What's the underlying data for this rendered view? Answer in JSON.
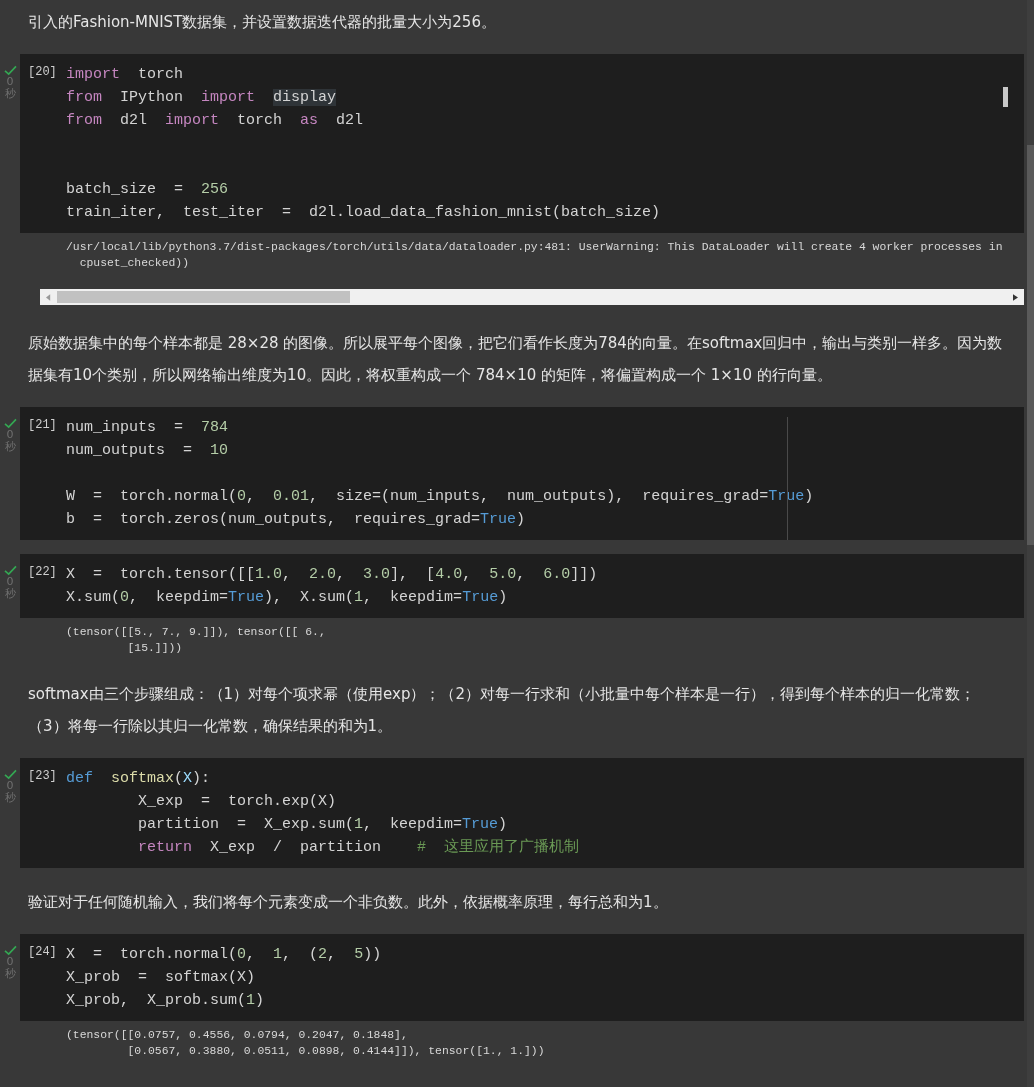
{
  "cells": [
    {
      "kind": "text",
      "text": "引入的Fashion-MNIST数据集，并设置数据迭代器的批量大小为256。"
    },
    {
      "kind": "code",
      "count": "[20]",
      "done": true,
      "time": "0",
      "unit": "秒",
      "cursor_thumb": true,
      "lines": [
        {
          "kind": "code",
          "tokens": [
            {
              "kind": "keyword",
              "text": "import"
            },
            {
              "kind": "plain",
              "text": "  torch"
            }
          ]
        },
        {
          "kind": "code",
          "tokens": [
            {
              "kind": "keyword",
              "text": "from"
            },
            {
              "kind": "plain",
              "text": "  IPython  "
            },
            {
              "kind": "keyword",
              "text": "import  "
            },
            {
              "kind": "highlight",
              "text": "display"
            }
          ]
        },
        {
          "kind": "code",
          "tokens": [
            {
              "kind": "keyword",
              "text": "from"
            },
            {
              "kind": "plain",
              "text": "  d2l  "
            },
            {
              "kind": "keyword",
              "text": "import"
            },
            {
              "kind": "plain",
              "text": "  torch  "
            },
            {
              "kind": "keyword",
              "text": "as"
            },
            {
              "kind": "plain",
              "text": "  d2l"
            }
          ]
        },
        {
          "kind": "blank"
        },
        {
          "kind": "blank"
        },
        {
          "kind": "code",
          "tokens": [
            {
              "kind": "plain",
              "text": "batch_size  =  "
            },
            {
              "kind": "number",
              "text": "256"
            }
          ]
        },
        {
          "kind": "code",
          "tokens": [
            {
              "kind": "plain",
              "text": "train_iter,  test_iter  =  d2l.load_data_fashion_mnist(batch_size)"
            }
          ]
        }
      ],
      "output": {
        "horizontal_scroll": true,
        "lines": [
          "/usr/local/lib/python3.7/dist-packages/torch/utils/data/dataloader.py:481: UserWarning: This DataLoader will create 4 worker processes in",
          "  cpuset_checked))"
        ]
      }
    },
    {
      "kind": "text",
      "text": "原始数据集中的每个样本都是 28×28 的图像。所以展平每个图像，把它们看作长度为784的向量。在softmax回归中，输出与类别一样多。因为数据集有10个类别，所以网络输出维度为10。因此，将权重构成一个 784×10 的矩阵，将偏置构成一个 1×10 的行向量。"
    },
    {
      "kind": "code",
      "count": "[21]",
      "done": true,
      "time": "0",
      "unit": "秒",
      "ruler": true,
      "lines": [
        {
          "kind": "code",
          "tokens": [
            {
              "kind": "plain",
              "text": "num_inputs  =  "
            },
            {
              "kind": "number",
              "text": "784"
            }
          ]
        },
        {
          "kind": "code",
          "tokens": [
            {
              "kind": "plain",
              "text": "num_outputs  =  "
            },
            {
              "kind": "number",
              "text": "10"
            }
          ]
        },
        {
          "kind": "blank"
        },
        {
          "kind": "code",
          "tokens": [
            {
              "kind": "plain",
              "text": "W  =  torch.normal("
            },
            {
              "kind": "number",
              "text": "0"
            },
            {
              "kind": "plain",
              "text": ",  "
            },
            {
              "kind": "number",
              "text": "0.01"
            },
            {
              "kind": "plain",
              "text": ",  size=(num_inputs,  num_outputs),  requires_grad="
            },
            {
              "kind": "constant",
              "text": "True"
            },
            {
              "kind": "plain",
              "text": ")"
            }
          ]
        },
        {
          "kind": "code",
          "tokens": [
            {
              "kind": "plain",
              "text": "b  =  torch.zeros(num_outputs,  requires_grad="
            },
            {
              "kind": "constant",
              "text": "True"
            },
            {
              "kind": "plain",
              "text": ")"
            }
          ]
        }
      ]
    },
    {
      "kind": "code",
      "count": "[22]",
      "done": true,
      "time": "0",
      "unit": "秒",
      "lines": [
        {
          "kind": "code",
          "tokens": [
            {
              "kind": "plain",
              "text": "X  =  torch.tensor([["
            },
            {
              "kind": "number",
              "text": "1.0"
            },
            {
              "kind": "plain",
              "text": ",  "
            },
            {
              "kind": "number",
              "text": "2.0"
            },
            {
              "kind": "plain",
              "text": ",  "
            },
            {
              "kind": "number",
              "text": "3.0"
            },
            {
              "kind": "plain",
              "text": "],  ["
            },
            {
              "kind": "number",
              "text": "4.0"
            },
            {
              "kind": "plain",
              "text": ",  "
            },
            {
              "kind": "number",
              "text": "5.0"
            },
            {
              "kind": "plain",
              "text": ",  "
            },
            {
              "kind": "number",
              "text": "6.0"
            },
            {
              "kind": "plain",
              "text": "]])"
            }
          ]
        },
        {
          "kind": "code",
          "tokens": [
            {
              "kind": "plain",
              "text": "X.sum("
            },
            {
              "kind": "number",
              "text": "0"
            },
            {
              "kind": "plain",
              "text": ",  keepdim="
            },
            {
              "kind": "constant",
              "text": "True"
            },
            {
              "kind": "plain",
              "text": "),  X.sum("
            },
            {
              "kind": "number",
              "text": "1"
            },
            {
              "kind": "plain",
              "text": ",  keepdim="
            },
            {
              "kind": "constant",
              "text": "True"
            },
            {
              "kind": "plain",
              "text": ")"
            }
          ]
        }
      ],
      "output": {
        "lines": [
          "(tensor([[5., 7., 9.]]), tensor([[ 6.,",
          "         [15.]]))"
        ]
      }
    },
    {
      "kind": "text",
      "text": "softmax由三个步骤组成：（1）对每个项求幂（使用exp）；（2）对每一行求和（小批量中每个样本是一行），得到每个样本的归一化常数；（3）将每一行除以其归一化常数，确保结果的和为1。"
    },
    {
      "kind": "code",
      "count": "[23]",
      "done": true,
      "time": "0",
      "unit": "秒",
      "lines": [
        {
          "kind": "code",
          "tokens": [
            {
              "kind": "def",
              "text": "def  "
            },
            {
              "kind": "function",
              "text": "softmax"
            },
            {
              "kind": "plain",
              "text": "("
            },
            {
              "kind": "variable",
              "text": "X"
            },
            {
              "kind": "plain",
              "text": "):"
            }
          ]
        },
        {
          "kind": "code",
          "tokens": [
            {
              "kind": "plain",
              "text": "        X_exp  =  torch.exp(X)"
            }
          ]
        },
        {
          "kind": "code",
          "tokens": [
            {
              "kind": "plain",
              "text": "        partition  =  X_exp.sum("
            },
            {
              "kind": "number",
              "text": "1"
            },
            {
              "kind": "plain",
              "text": ",  keepdim="
            },
            {
              "kind": "constant",
              "text": "True"
            },
            {
              "kind": "plain",
              "text": ")"
            }
          ]
        },
        {
          "kind": "code",
          "tokens": [
            {
              "kind": "keyword",
              "text": "        return"
            },
            {
              "kind": "plain",
              "text": "  X_exp  /  partition    "
            },
            {
              "kind": "comment",
              "text": "#  这里应用了广播机制"
            }
          ]
        }
      ]
    },
    {
      "kind": "text",
      "text": "验证对于任何随机输入，我们将每个元素变成一个非负数。此外，依据概率原理，每行总和为1。"
    },
    {
      "kind": "code",
      "count": "[24]",
      "done": true,
      "time": "0",
      "unit": "秒",
      "lines": [
        {
          "kind": "code",
          "tokens": [
            {
              "kind": "plain",
              "text": "X  =  torch.normal("
            },
            {
              "kind": "number",
              "text": "0"
            },
            {
              "kind": "plain",
              "text": ",  "
            },
            {
              "kind": "number",
              "text": "1"
            },
            {
              "kind": "plain",
              "text": ",  ("
            },
            {
              "kind": "number",
              "text": "2"
            },
            {
              "kind": "plain",
              "text": ",  "
            },
            {
              "kind": "number",
              "text": "5"
            },
            {
              "kind": "plain",
              "text": "))"
            }
          ]
        },
        {
          "kind": "code",
          "tokens": [
            {
              "kind": "plain",
              "text": "X_prob  =  softmax(X)"
            }
          ]
        },
        {
          "kind": "code",
          "tokens": [
            {
              "kind": "plain",
              "text": "X_prob,  X_prob.sum("
            },
            {
              "kind": "number",
              "text": "1"
            },
            {
              "kind": "plain",
              "text": ")"
            }
          ]
        }
      ],
      "output": {
        "lines": [
          "(tensor([[0.0757, 0.4556, 0.0794, 0.2047, 0.1848],",
          "         [0.0567, 0.3880, 0.0511, 0.0898, 0.4144]]), tensor([1., 1.]))"
        ]
      }
    }
  ]
}
